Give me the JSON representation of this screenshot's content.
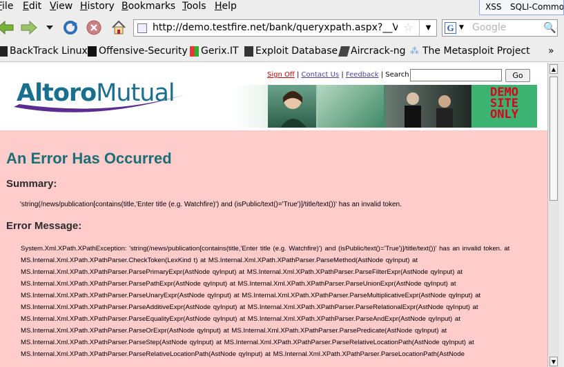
{
  "menu": {
    "file": "File",
    "edit": "Edit",
    "view": "View",
    "history": "History",
    "bookmarks": "Bookmarks",
    "tools": "Tools",
    "help": "Help"
  },
  "tabs": [
    "XSS",
    "SQLI-Commo"
  ],
  "navbar": {
    "url": "http://demo.testfire.net/bank/queryxpath.aspx?__VIEW",
    "search_placeholder": "Google"
  },
  "bookmarks": [
    "BackTrack Linux",
    "Offensive-Security",
    "Gerix.IT",
    "Exploit Database",
    "Aircrack-ng",
    "The Metasploit Project"
  ],
  "bookmarks_more": "»",
  "header": {
    "sign_off": "Sign Off",
    "contact_us": "Contact Us",
    "feedback": "Feedback",
    "search_label": "Search",
    "sep": "|",
    "go": "Go",
    "logo_part1": "Altoro",
    "logo_part2": "Mutual",
    "demo_line1": "DEMO",
    "demo_line2": "SITE",
    "demo_line3": "ONLY"
  },
  "page": {
    "title": "An Error Has Occurred",
    "summary_heading": "Summary:",
    "summary_text": "'string(/news/publication[contains(title,'Enter title (e.g. Watchfire)') and (isPublic/text()='True')]/title/text())' has an invalid token.",
    "error_heading": "Error Message:",
    "error_text": "System.Xml.XPath.XPathException: 'string(/news/publication[contains(title,'Enter title (e.g. Watchfire)') and (isPublic/text()='True')]/title/text())' has an invalid token. at MS.Internal.Xml.XPath.XPathParser.CheckToken(LexKind t) at MS.Internal.Xml.XPath.XPathParser.ParseMethod(AstNode qyInput) at MS.Internal.Xml.XPath.XPathParser.ParsePrimaryExpr(AstNode qyInput) at MS.Internal.Xml.XPath.XPathParser.ParseFilterExpr(AstNode qyInput) at MS.Internal.Xml.XPath.XPathParser.ParsePathExpr(AstNode qyInput) at MS.Internal.Xml.XPath.XPathParser.ParseUnionExpr(AstNode qyInput) at MS.Internal.Xml.XPath.XPathParser.ParseUnaryExpr(AstNode qyInput) at MS.Internal.Xml.XPath.XPathParser.ParseMultiplicativeExpr(AstNode qyInput) at MS.Internal.Xml.XPath.XPathParser.ParseAdditiveExpr(AstNode qyInput) at MS.Internal.Xml.XPath.XPathParser.ParseRelationalExpr(AstNode qyInput) at MS.Internal.Xml.XPath.XPathParser.ParseEqualityExpr(AstNode qyInput) at MS.Internal.Xml.XPath.XPathParser.ParseAndExpr(AstNode qyInput) at MS.Internal.Xml.XPath.XPathParser.ParseOrExpr(AstNode qyInput) at MS.Internal.Xml.XPath.XPathParser.ParsePredicate(AstNode qyInput) at MS.Internal.Xml.XPath.XPathParser.ParseStep(AstNode qyInput) at MS.Internal.Xml.XPath.XPathParser.ParseRelativeLocationPath(AstNode qyInput) at MS.Internal.Xml.XPath.XPathParser.ParseRelativeLocationPath(AstNode qyInput) at MS.Internal.Xml.XPath.XPathParser.ParseLocationPath(AstNode"
  },
  "colors": {
    "content_bg": "#ffcccc",
    "title": "#1a6e74",
    "logo": "#1a6e8e",
    "demo_bg": "#3cb371",
    "demo_text": "#d9001b"
  }
}
